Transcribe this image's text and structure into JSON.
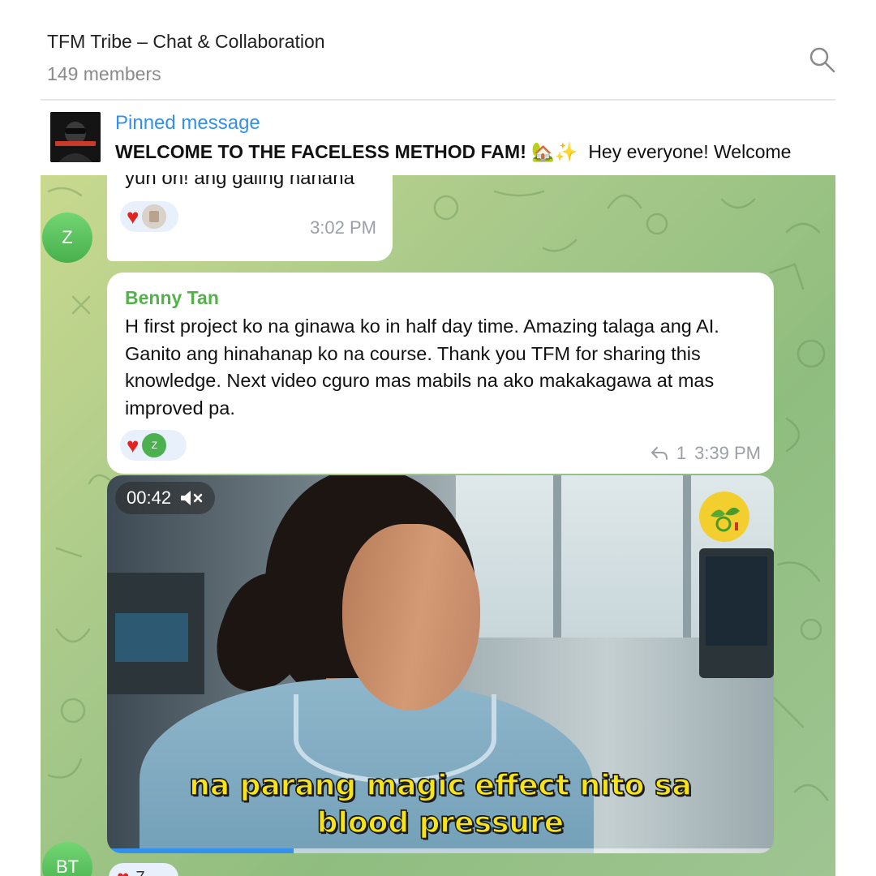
{
  "header": {
    "title": "TFM Tribe – Chat & Collaboration",
    "members": "149 members"
  },
  "pinned": {
    "label": "Pinned message",
    "text_bold": "WELCOME TO THE FACELESS METHOD FAM! 🏡✨",
    "text_rest": "Hey everyone! Welcome"
  },
  "messages": [
    {
      "text": "yun oh! ang galing hahaha",
      "time": "3:02 PM",
      "avatar_initial": "Z"
    },
    {
      "sender": "Benny Tan",
      "text": "H first project ko na ginawa ko in half day time.   Amazing talaga ang AI.  Ganito ang hinahanap ko na course. Thank you TFM for sharing this knowledge.  Next video cguro mas mabils na ako makakagawa at mas improved pa.",
      "reaction_avatar": "Z",
      "replies": "1",
      "time": "3:39 PM"
    }
  ],
  "video": {
    "duration": "00:42",
    "caption_line1": "na parang magic effect nito sa",
    "caption_line2": "blood pressure",
    "progress": 0.28
  },
  "bottom_avatar": "BT",
  "bottom_reaction_count": "7",
  "colors": {
    "accent": "#3390ec",
    "sender": "#55b24a",
    "heart": "#e0241f"
  }
}
